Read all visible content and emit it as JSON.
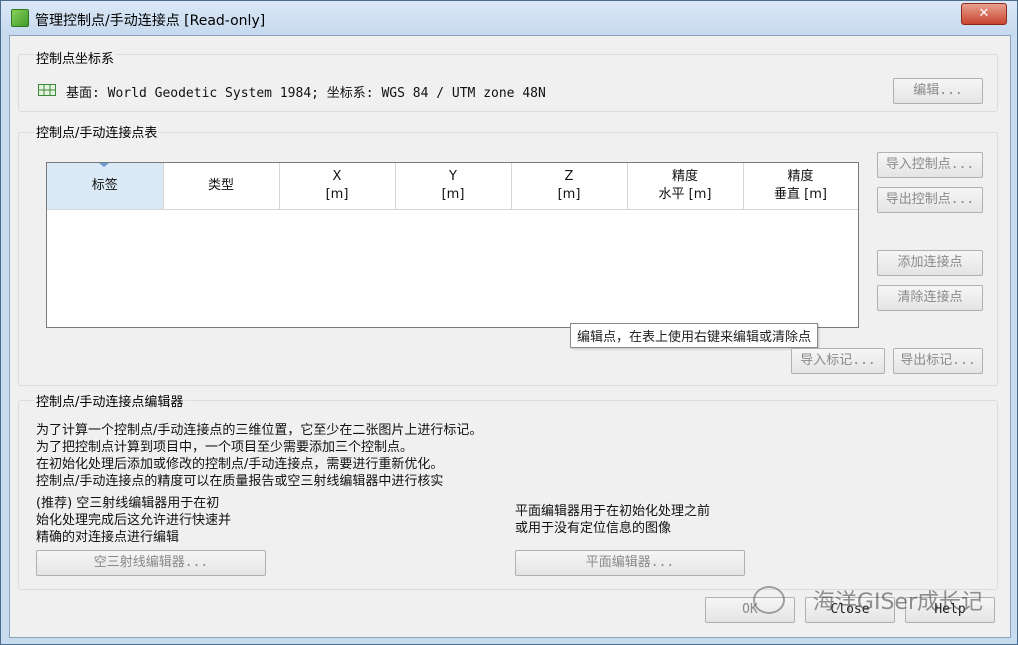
{
  "window": {
    "title": "管理控制点/手动连接点 [Read-only]",
    "close_label": "✕"
  },
  "crs_group": {
    "title": "控制点坐标系",
    "text": "基面: World Geodetic System 1984; 坐标系: WGS 84 / UTM zone 48N",
    "edit_button": "编辑..."
  },
  "table_group": {
    "title": "控制点/手动连接点表",
    "columns": [
      {
        "line1": "标签",
        "line2": ""
      },
      {
        "line1": "类型",
        "line2": ""
      },
      {
        "line1": "X",
        "line2": "[m]"
      },
      {
        "line1": "Y",
        "line2": "[m]"
      },
      {
        "line1": "Z",
        "line2": "[m]"
      },
      {
        "line1": "精度",
        "line2": "水平 [m]"
      },
      {
        "line1": "精度",
        "line2": "垂直 [m]"
      }
    ],
    "buttons": {
      "import_gcp": "导入控制点...",
      "export_gcp": "导出控制点...",
      "add_tie": "添加连接点",
      "remove_tie": "清除连接点",
      "import_marks": "导入标记...",
      "export_marks": "导出标记..."
    },
    "tooltip": "编辑点，在表上使用右键来编辑或清除点"
  },
  "editor_group": {
    "title": "控制点/手动连接点编辑器",
    "lines": [
      "为了计算一个控制点/手动连接点的三维位置，它至少在二张图片上进行标记。",
      "为了把控制点计算到项目中，一个项目至少需要添加三个控制点。",
      "在初始化处理后添加或修改的控制点/手动连接点，需要进行重新优化。",
      "控制点/手动连接点的精度可以在质量报告或空三射线编辑器中进行核实"
    ],
    "left_desc": [
      "(推荐) 空三射线编辑器用于在初",
      "始化处理完成后这允许进行快速并",
      "精确的对连接点进行编辑"
    ],
    "right_desc": [
      "平面编辑器用于在初始化处理之前",
      "或用于没有定位信息的图像"
    ],
    "ray_editor_button": "空三射线编辑器...",
    "plane_editor_button": "平面编辑器..."
  },
  "footer": {
    "ok": "OK",
    "close": "Close",
    "help": "Help",
    "watermark": "海洋GISer成长记"
  },
  "colors": {
    "title_bg": "#c6d9ee",
    "close_red": "#c8452f",
    "header_selected": "#dbe9f7"
  }
}
